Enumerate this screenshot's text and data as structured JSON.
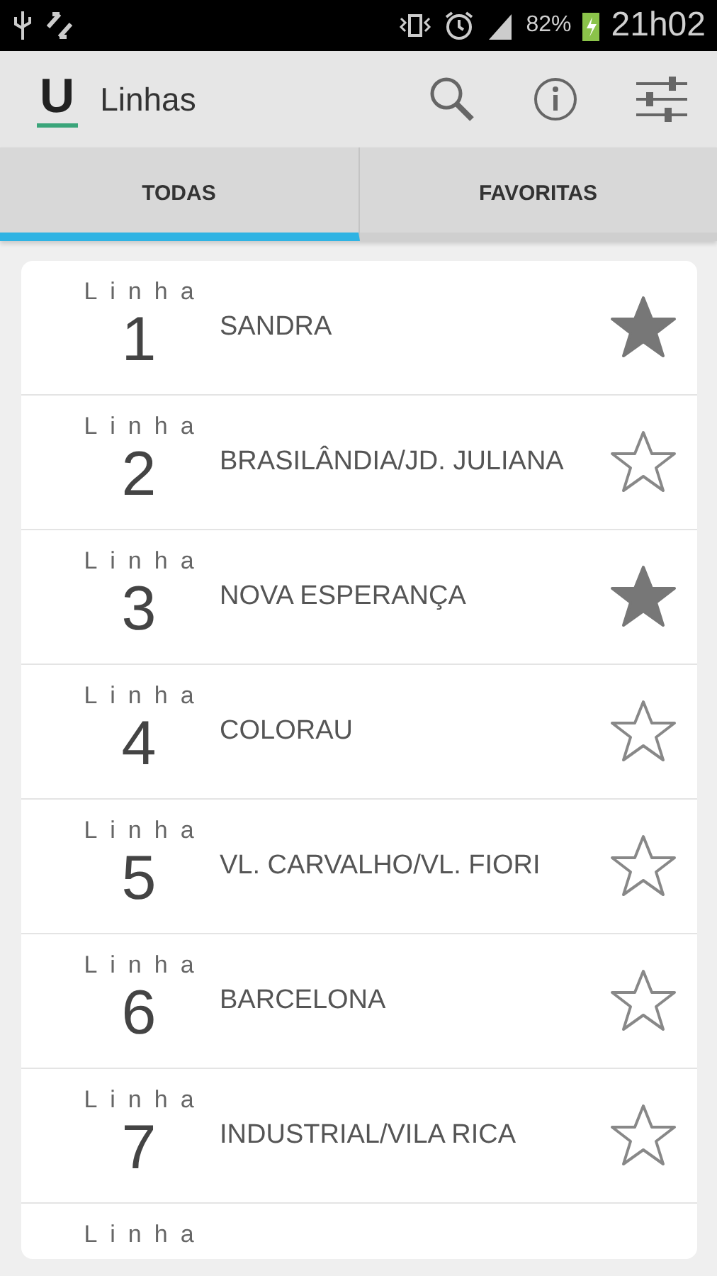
{
  "status_bar": {
    "battery": "82%",
    "time": "21h02"
  },
  "action_bar": {
    "logo": "U",
    "title": "Linhas"
  },
  "tabs": [
    {
      "label": "TODAS",
      "selected": true
    },
    {
      "label": "FAVORITAS",
      "selected": false
    }
  ],
  "lines": [
    {
      "label": "Linha",
      "number": "1",
      "name": "SANDRA",
      "favorite": true
    },
    {
      "label": "Linha",
      "number": "2",
      "name": "BRASILÂNDIA/JD. JULIANA",
      "favorite": false
    },
    {
      "label": "Linha",
      "number": "3",
      "name": "NOVA ESPERANÇA",
      "favorite": true
    },
    {
      "label": "Linha",
      "number": "4",
      "name": "COLORAU",
      "favorite": false
    },
    {
      "label": "Linha",
      "number": "5",
      "name": "VL. CARVALHO/VL. FIORI",
      "favorite": false
    },
    {
      "label": "Linha",
      "number": "6",
      "name": "BARCELONA",
      "favorite": false
    },
    {
      "label": "Linha",
      "number": "7",
      "name": "INDUSTRIAL/VILA RICA",
      "favorite": false
    },
    {
      "label": "Linha"
    }
  ]
}
